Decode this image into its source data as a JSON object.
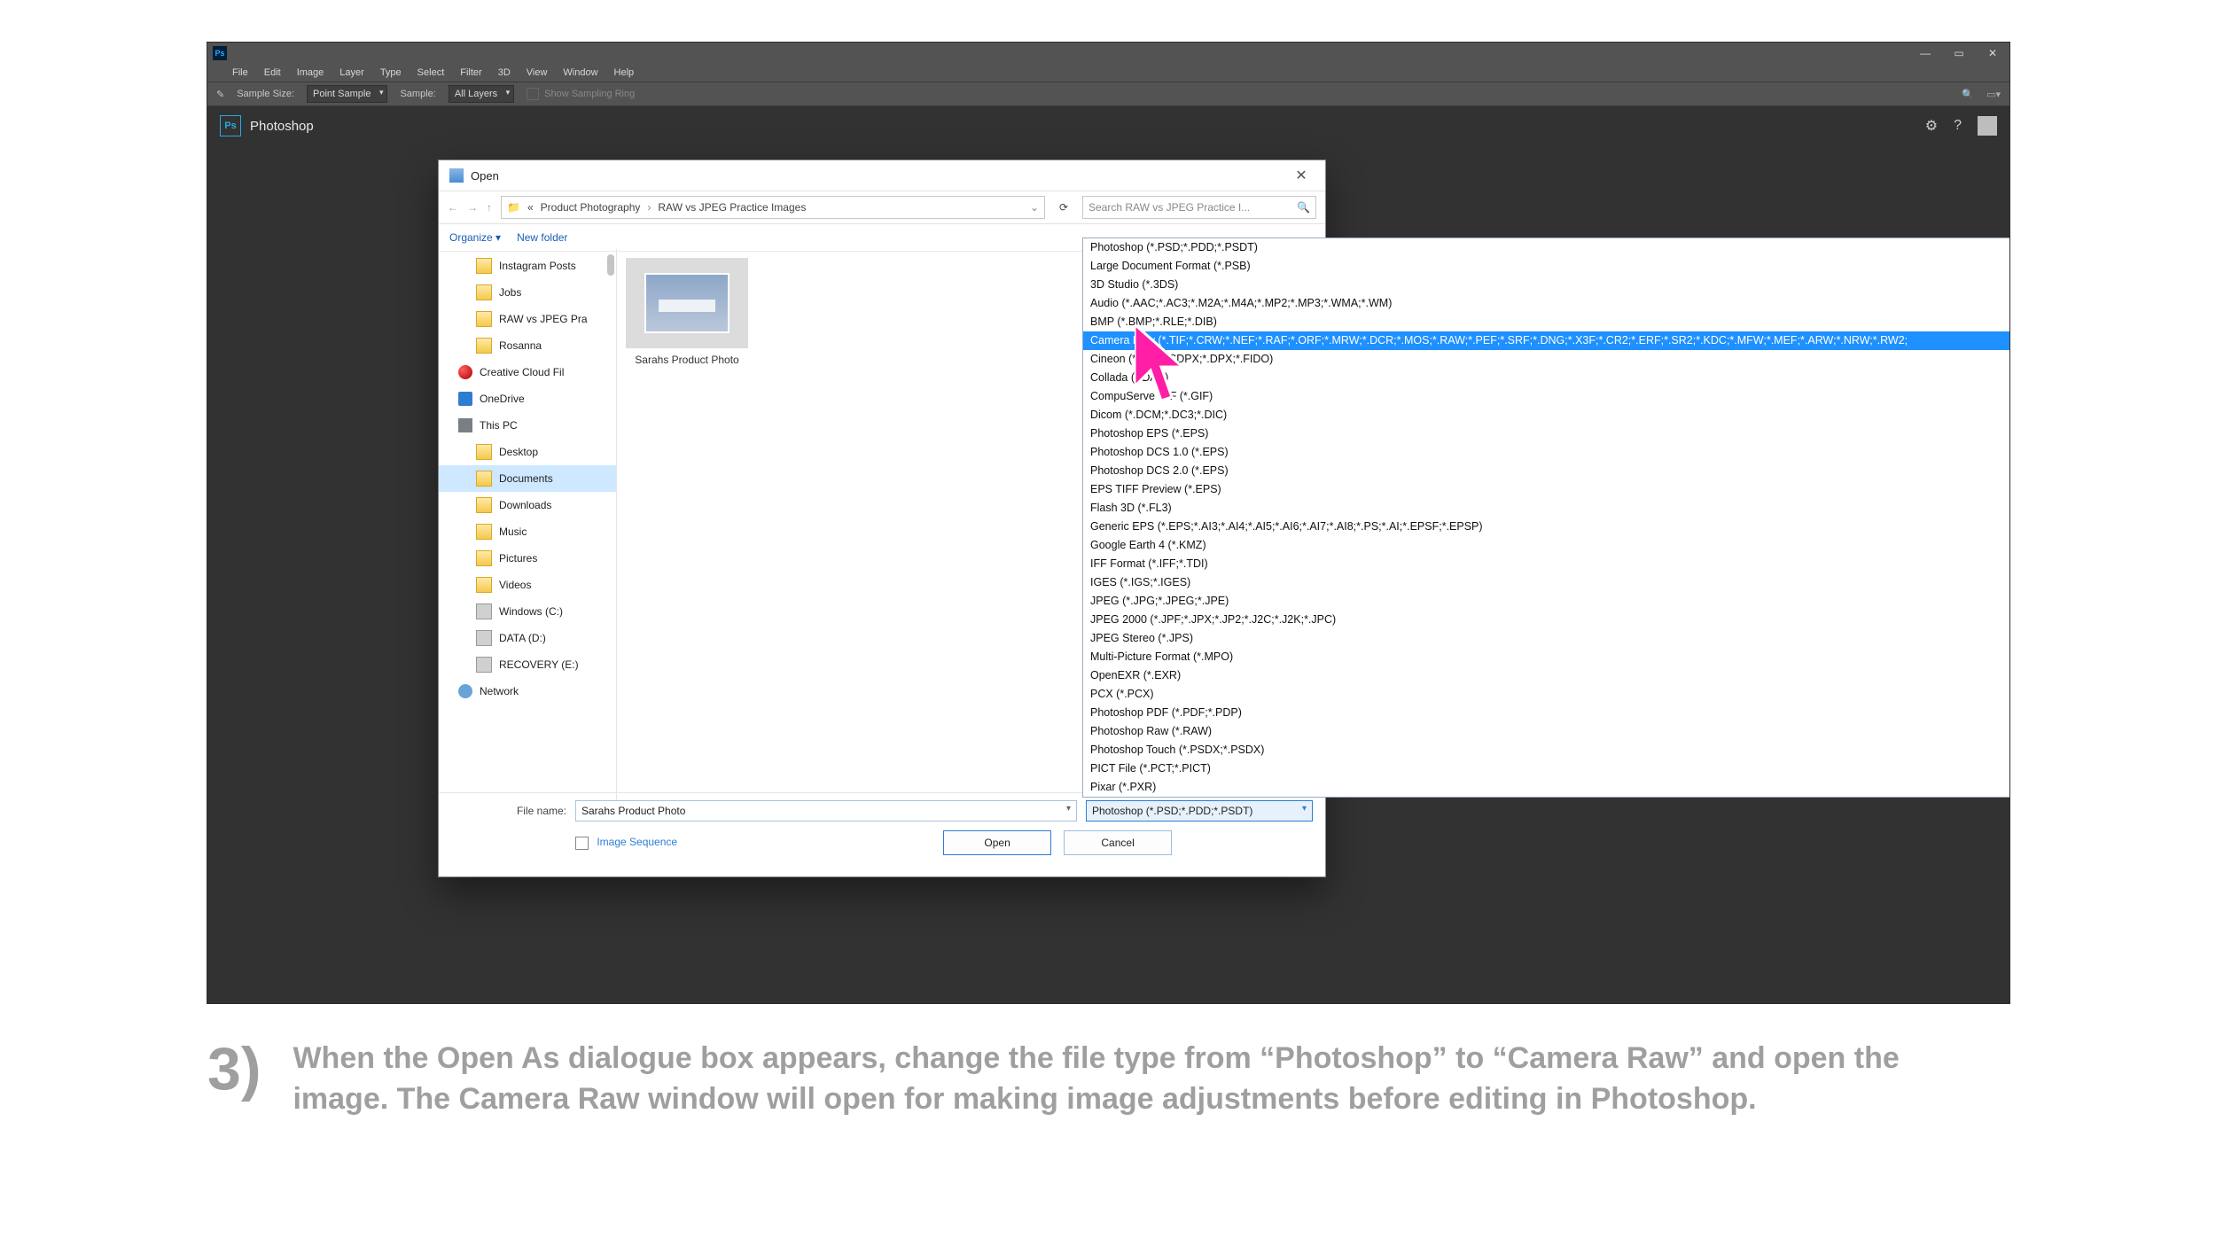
{
  "app": {
    "logo_text": "Ps",
    "name": "Photoshop",
    "menu": [
      "File",
      "Edit",
      "Image",
      "Layer",
      "Type",
      "Select",
      "Filter",
      "3D",
      "View",
      "Window",
      "Help"
    ]
  },
  "options_bar": {
    "sample_size_label": "Sample Size:",
    "sample_size_value": "Point Sample",
    "sample_label": "Sample:",
    "sample_value": "All Layers",
    "show_ring": "Show Sampling Ring"
  },
  "dialog": {
    "title": "Open",
    "breadcrumb_prefix": "«",
    "breadcrumb_1": "Product Photography",
    "breadcrumb_2": "RAW vs JPEG Practice Images",
    "search_placeholder": "Search RAW vs JPEG Practice I...",
    "organize": "Organize ▾",
    "new_folder": "New folder",
    "tree": [
      {
        "label": "Instagram Posts",
        "icon": "folder",
        "sub": true
      },
      {
        "label": "Jobs",
        "icon": "folder",
        "sub": true
      },
      {
        "label": "RAW vs JPEG Pra",
        "icon": "folder",
        "sub": true
      },
      {
        "label": "Rosanna",
        "icon": "folder",
        "sub": true
      },
      {
        "label": "Creative Cloud Fil",
        "icon": "cc",
        "sub": false
      },
      {
        "label": "OneDrive",
        "icon": "od",
        "sub": false
      },
      {
        "label": "This PC",
        "icon": "pc",
        "sub": false
      },
      {
        "label": "Desktop",
        "icon": "folder",
        "sub": true
      },
      {
        "label": "Documents",
        "icon": "folder",
        "sub": true,
        "selected": true
      },
      {
        "label": "Downloads",
        "icon": "folder",
        "sub": true
      },
      {
        "label": "Music",
        "icon": "folder",
        "sub": true
      },
      {
        "label": "Pictures",
        "icon": "folder",
        "sub": true
      },
      {
        "label": "Videos",
        "icon": "folder",
        "sub": true
      },
      {
        "label": "Windows (C:)",
        "icon": "drive",
        "sub": true
      },
      {
        "label": "DATA (D:)",
        "icon": "drive",
        "sub": true
      },
      {
        "label": "RECOVERY (E:)",
        "icon": "drive",
        "sub": true
      },
      {
        "label": "Network",
        "icon": "net",
        "sub": false
      }
    ],
    "file_tile_name": "Sarahs Product Photo",
    "file_name_label": "File name:",
    "file_name_value": "Sarahs Product Photo",
    "file_type_value": "Photoshop (*.PSD;*.PDD;*.PSDT)",
    "image_sequence": "Image Sequence",
    "open_btn": "Open",
    "cancel_btn": "Cancel"
  },
  "file_types": [
    "Photoshop (*.PSD;*.PDD;*.PSDT)",
    "Large Document Format (*.PSB)",
    "3D Studio (*.3DS)",
    "Audio (*.AAC;*.AC3;*.M2A;*.M4A;*.MP2;*.MP3;*.WMA;*.WM)",
    "BMP (*.BMP;*.RLE;*.DIB)",
    "Camera Raw (*.TIF;*.CRW;*.NEF;*.RAF;*.ORF;*.MRW;*.DCR;*.MOS;*.RAW;*.PEF;*.SRF;*.DNG;*.X3F;*.CR2;*.ERF;*.SR2;*.KDC;*.MFW;*.MEF;*.ARW;*.NRW;*.RW2;",
    "Cineon (*.CIN;*.SDPX;*.DPX;*.FIDO)",
    "Collada (*.DAE)",
    "CompuServe GIF (*.GIF)",
    "Dicom (*.DCM;*.DC3;*.DIC)",
    "Photoshop EPS (*.EPS)",
    "Photoshop DCS 1.0 (*.EPS)",
    "Photoshop DCS 2.0 (*.EPS)",
    "EPS TIFF Preview (*.EPS)",
    "Flash 3D (*.FL3)",
    "Generic EPS (*.EPS;*.AI3;*.AI4;*.AI5;*.AI6;*.AI7;*.AI8;*.PS;*.AI;*.EPSF;*.EPSP)",
    "Google Earth 4 (*.KMZ)",
    "IFF Format (*.IFF;*.TDI)",
    "IGES (*.IGS;*.IGES)",
    "JPEG (*.JPG;*.JPEG;*.JPE)",
    "JPEG 2000 (*.JPF;*.JPX;*.JP2;*.J2C;*.J2K;*.JPC)",
    "JPEG Stereo (*.JPS)",
    "Multi-Picture Format (*.MPO)",
    "OpenEXR (*.EXR)",
    "PCX (*.PCX)",
    "Photoshop PDF (*.PDF;*.PDP)",
    "Photoshop Raw (*.RAW)",
    "Photoshop Touch (*.PSDX;*.PSDX)",
    "PICT File (*.PCT;*.PICT)",
    "Pixar (*.PXR)"
  ],
  "file_types_selected_index": 5,
  "instruction": {
    "step": "3)",
    "text": "When the Open As dialogue box appears, change the file type from “Photoshop” to “Camera Raw” and open the image. The Camera Raw window will open for making image adjustments before editing in Photoshop."
  }
}
